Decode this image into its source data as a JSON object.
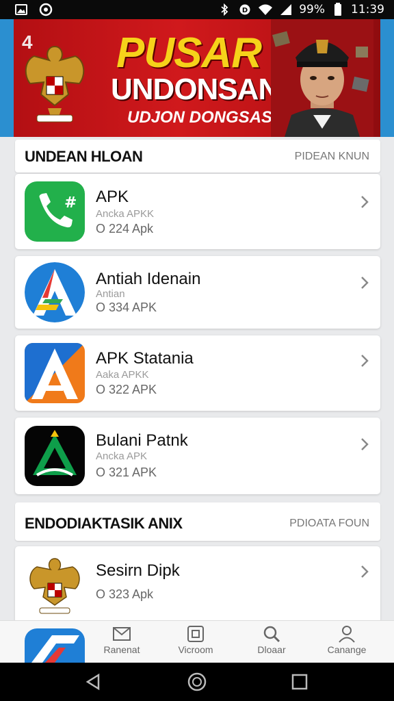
{
  "status_bar": {
    "battery": "99%",
    "time": "11:39",
    "icons": [
      "gallery-icon",
      "notification-icon",
      "bluetooth-icon",
      "data-saver-icon",
      "wifi-icon",
      "signal-icon",
      "battery-icon"
    ]
  },
  "banner": {
    "number": "4",
    "title": "PUSAR",
    "subtitle": "UNDONSAN",
    "tagline": "UDJON DONGSAS"
  },
  "section1": {
    "title": "UNDEAN HLOAN",
    "more": "PIDEAN KNUN"
  },
  "apps": [
    {
      "name": "APK",
      "meta": "Ancka APKK",
      "size": "O 224 Apk",
      "icon": "phone-app-icon"
    },
    {
      "name": "Antiah Idenain",
      "meta": "Antian",
      "size": "O 334 APK",
      "icon": "a-logo-app-icon"
    },
    {
      "name": "APK Statania",
      "meta": "Aaka APKK",
      "size": "O 322 APK",
      "icon": "a-triangle-app-icon"
    },
    {
      "name": "Bulani Patnk",
      "meta": "Ancka APK",
      "size": "O 321 APK",
      "icon": "green-triangle-app-icon"
    }
  ],
  "section2": {
    "title": "ENDODIAKTASIK ANIX",
    "more": "PDIOATA FOUN"
  },
  "featured": {
    "name": "Sesirn Dipk",
    "size": "O 323 Apk",
    "icon": "garuda-app-icon"
  },
  "bottom_nav": [
    {
      "label": "Ranenat",
      "icon": "mail-icon"
    },
    {
      "label": "Vicroom",
      "icon": "square-icon"
    },
    {
      "label": "Dloaar",
      "icon": "search-icon"
    },
    {
      "label": "Canange",
      "icon": "profile-icon"
    }
  ],
  "colors": {
    "banner_red": "#d0191c",
    "banner_yellow": "#f6d21a",
    "phone_green": "#22b04b",
    "accent_blue": "#1f7fd6"
  }
}
